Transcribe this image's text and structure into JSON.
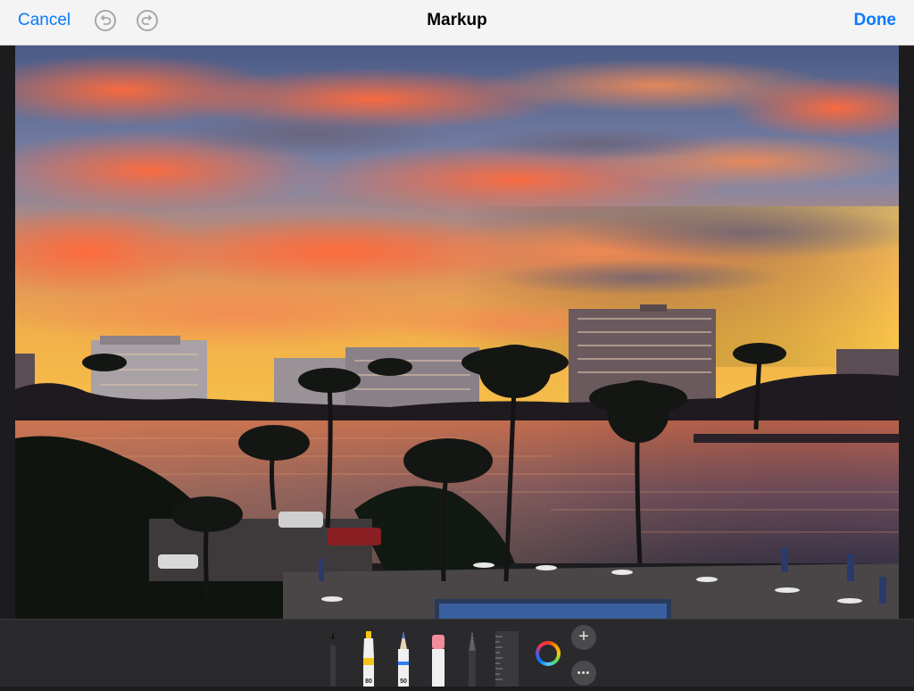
{
  "navbar": {
    "cancel_label": "Cancel",
    "title": "Markup",
    "done_label": "Done",
    "undo_icon": "undo-icon",
    "redo_icon": "redo-icon"
  },
  "photo": {
    "subject": "sunset-over-waterway-with-palm-trees"
  },
  "tools": {
    "pen": {
      "icon": "pen-icon",
      "label": ""
    },
    "highlighter": {
      "icon": "highlighter-icon",
      "label": "80",
      "color": "#f5c518"
    },
    "pencil": {
      "icon": "pencil-icon",
      "label": "50",
      "color": "#2f7df6"
    },
    "eraser": {
      "icon": "eraser-icon",
      "color": "#f28b9b"
    },
    "lasso": {
      "icon": "lasso-icon"
    },
    "ruler": {
      "icon": "ruler-icon"
    },
    "color_picker": {
      "icon": "color-wheel-icon"
    },
    "add_button": {
      "label": "+"
    },
    "more_button": {
      "label": "•••"
    }
  },
  "colors": {
    "accent": "#0a7aff",
    "toolbar_bg": "#2a2a2c"
  }
}
